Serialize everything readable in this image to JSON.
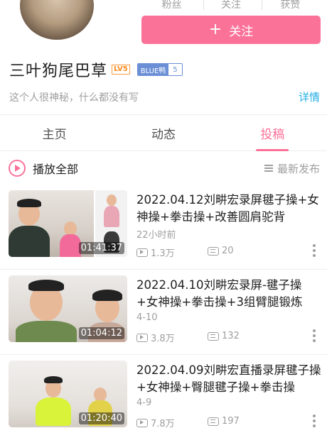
{
  "profile": {
    "stats_labels": [
      "粉丝",
      "关注",
      "获赞"
    ],
    "follow_label": "关注",
    "name": "三叶狗尾巴草",
    "level_badge": "LV5",
    "medal_name": "BLUE鸭",
    "medal_level": "5",
    "bio": "这个人很神秘，什么都没有写",
    "detail_link": "详情"
  },
  "tabs": [
    {
      "label": "主页",
      "active": false
    },
    {
      "label": "动态",
      "active": false
    },
    {
      "label": "投稿",
      "active": true
    }
  ],
  "playall": {
    "label": "播放全部",
    "sort_label": "最新发布"
  },
  "videos": [
    {
      "title": "2022.04.12刘畊宏录屏毽子操+女神操+拳击操+改善圆肩驼背",
      "date": "22小时前",
      "views": "1.3万",
      "danmaku": "20",
      "duration": "01:41:37"
    },
    {
      "title": "2022.04.10刘畊宏录屏-毽子操+女神操+拳击操+3组臂腿锻炼",
      "date": "4-10",
      "views": "3.8万",
      "danmaku": "132",
      "duration": "01:04:12"
    },
    {
      "title": "2022.04.09刘畊宏直播录屏毽子操+女神操+臀腿毽子操+拳击操",
      "date": "4-9",
      "views": "7.8万",
      "danmaku": "197",
      "duration": "01:20:40"
    }
  ],
  "colors": {
    "accent": "#fb7299",
    "link": "#23ade5",
    "muted": "#9e9e9e"
  }
}
